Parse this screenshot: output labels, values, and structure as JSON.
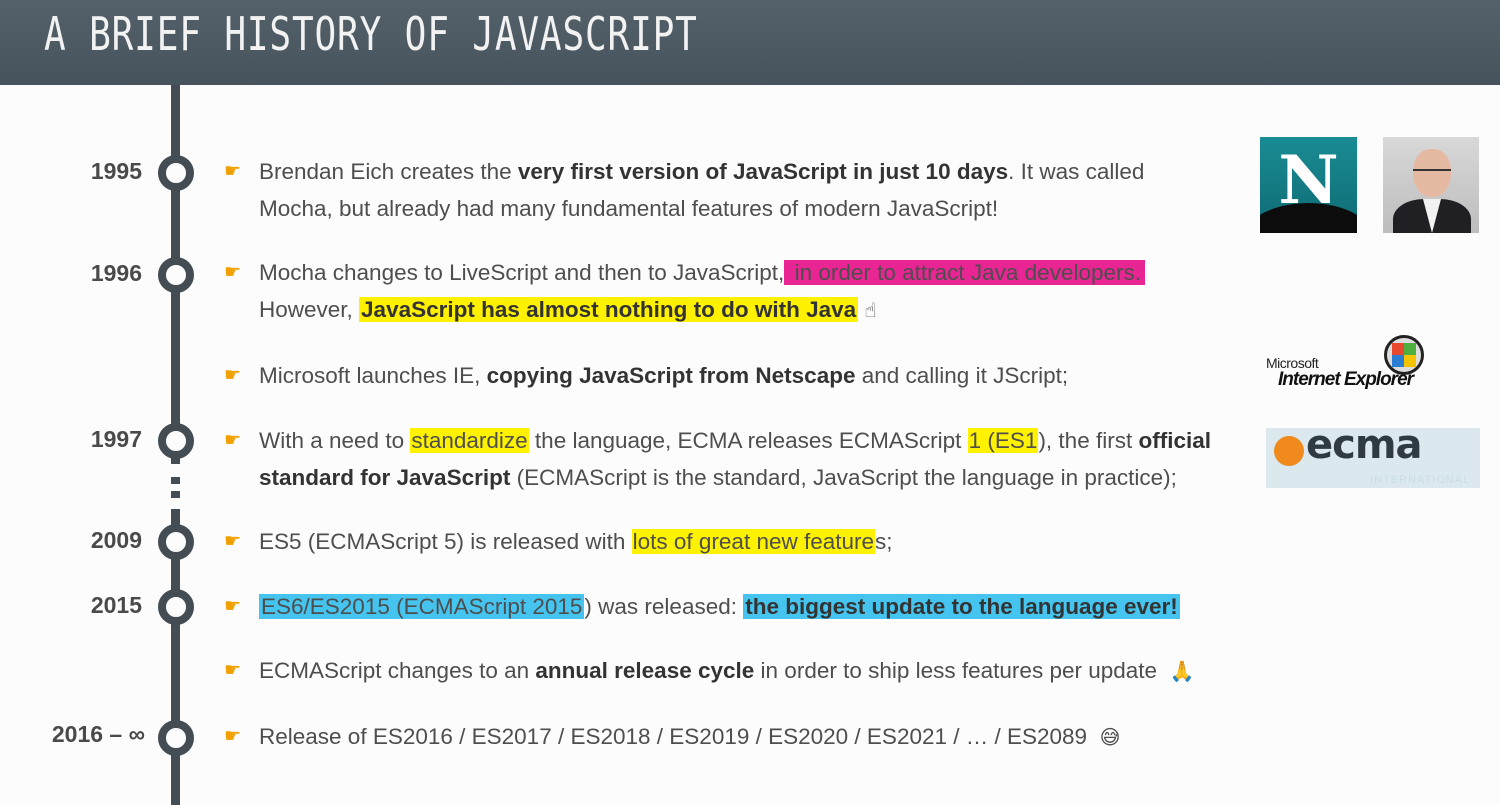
{
  "header": {
    "title": "A BRIEF HISTORY OF JAVASCRIPT"
  },
  "timeline": {
    "years": [
      "1995",
      "1996",
      "1997",
      "2009",
      "2015",
      "2016 – ∞"
    ]
  },
  "items": {
    "i1995": {
      "t1": "Brendan Eich creates the ",
      "b1": "very first version of JavaScript in just 10 days",
      "t2": ". It was called Mocha, but already had many fundamental features of modern JavaScript!"
    },
    "i1996": {
      "t1": "Mocha changes to LiveScript and then to JavaScript,",
      "h1": " in order to attract Java developers.",
      "t2": "However, ",
      "h2": "JavaScript has almost nothing to do with Java",
      "e1": "☝"
    },
    "ie": {
      "t1": "Microsoft launches IE, ",
      "b1": "copying JavaScript from Netscape",
      "t2": " and calling it JScript;"
    },
    "i1997": {
      "t1": "With a need to ",
      "h1": "standardize",
      "t2": " the language, ECMA releases ECMAScript ",
      "h2": "1 (ES1",
      "t3": "), the first ",
      "b1": "official standard for JavaScript",
      "t4": " (ECMAScript is the standard, JavaScript the language in practice);"
    },
    "i2009": {
      "t1": "ES5 (ECMAScript 5) is released with ",
      "h1": "lots of great new feature",
      "t2": "s;"
    },
    "i2015": {
      "h1": "ES6/ES2015 (ECMAScript 2015",
      "t1": ") was released: ",
      "h2": "the biggest update to the language ever!"
    },
    "annual": {
      "t1": "ECMAScript changes to an ",
      "b1": "annual release cycle",
      "t2": " in order to ship less features per update",
      "e1": "🙏"
    },
    "i2016": {
      "t1": "Release of ES2016 / ES2017 / ES2018 / ES2019 / ES2020 / ES2021 / … / ES2089",
      "e1": "😅"
    }
  },
  "logos": {
    "netscape_letter": "N",
    "ie_microsoft": "Microsoft",
    "ie_name": "Internet Explorer",
    "ecma_word": "ecma",
    "ecma_sub": "INTERNATIONAL"
  },
  "icons": {
    "bullet": "pointing-hand-icon"
  },
  "colors": {
    "header": "#4b5861",
    "timeline": "#444d53",
    "highlight_pink": "#e82592",
    "highlight_yellow": "#fff100",
    "highlight_blue": "#45c4ef"
  }
}
